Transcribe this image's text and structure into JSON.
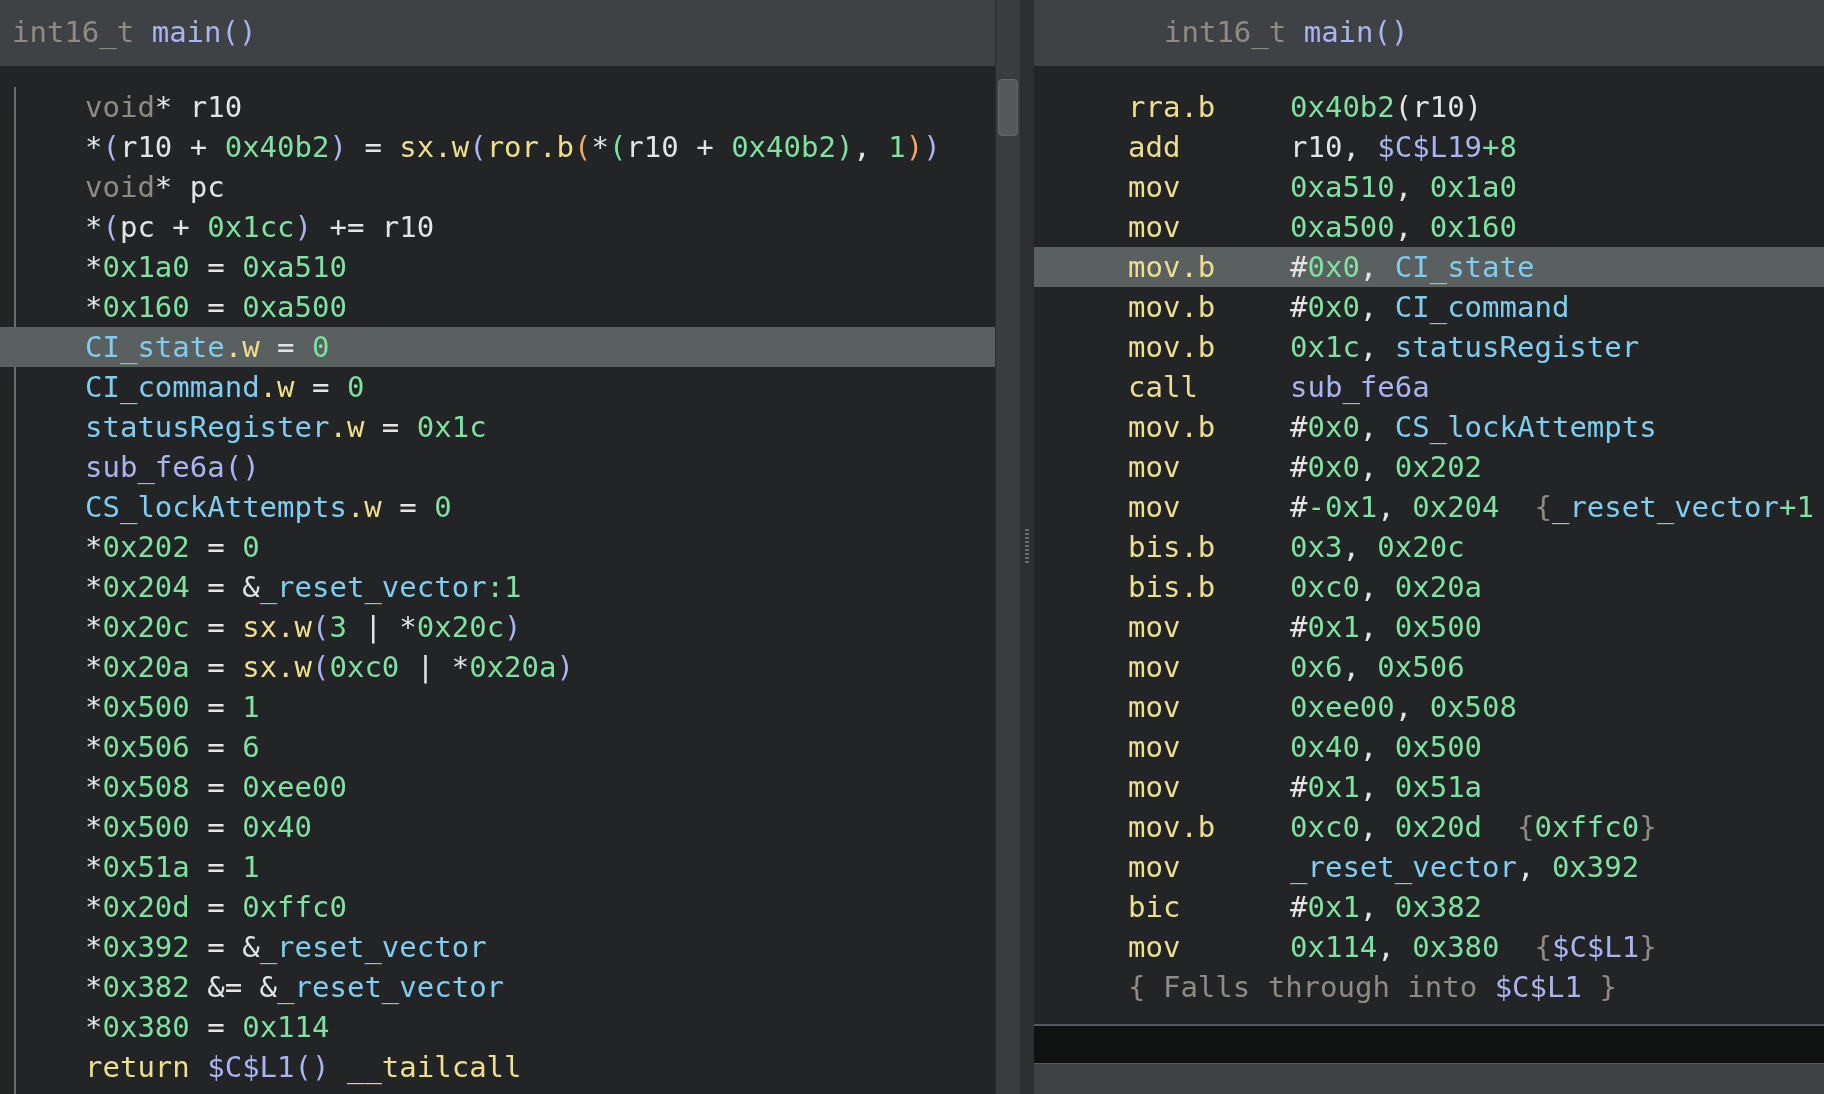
{
  "left_pane": {
    "header": [
      {
        "text": "int16_t ",
        "kind": "type"
      },
      {
        "text": "main",
        "kind": "func"
      },
      {
        "text": "()",
        "kind": "bracket"
      }
    ],
    "lines": [
      {
        "selected": false,
        "tokens": [
          {
            "text": "void",
            "kind": "type"
          },
          {
            "text": "* r10",
            "kind": "plain"
          }
        ]
      },
      {
        "selected": false,
        "tokens": [
          {
            "text": "*",
            "kind": "plain"
          },
          {
            "text": "(",
            "kind": "bracket"
          },
          {
            "text": "r10 + ",
            "kind": "plain"
          },
          {
            "text": "0x40b2",
            "kind": "number"
          },
          {
            "text": ")",
            "kind": "bracket"
          },
          {
            "text": " = ",
            "kind": "plain"
          },
          {
            "text": "sx.w",
            "kind": "keyword"
          },
          {
            "text": "(",
            "kind": "bracket"
          },
          {
            "text": "ror.b",
            "kind": "keyword"
          },
          {
            "text": "(",
            "kind": "bracket2"
          },
          {
            "text": "*",
            "kind": "plain"
          },
          {
            "text": "(",
            "kind": "number"
          },
          {
            "text": "r10 + ",
            "kind": "plain"
          },
          {
            "text": "0x40b2",
            "kind": "number"
          },
          {
            "text": ")",
            "kind": "number"
          },
          {
            "text": ", ",
            "kind": "plain"
          },
          {
            "text": "1",
            "kind": "number"
          },
          {
            "text": ")",
            "kind": "bracket2"
          },
          {
            "text": ")",
            "kind": "bracket"
          }
        ]
      },
      {
        "selected": false,
        "tokens": [
          {
            "text": "void",
            "kind": "type"
          },
          {
            "text": "* pc",
            "kind": "plain"
          }
        ]
      },
      {
        "selected": false,
        "tokens": [
          {
            "text": "*",
            "kind": "plain"
          },
          {
            "text": "(",
            "kind": "bracket"
          },
          {
            "text": "pc + ",
            "kind": "plain"
          },
          {
            "text": "0x1cc",
            "kind": "number"
          },
          {
            "text": ")",
            "kind": "bracket"
          },
          {
            "text": " += r10",
            "kind": "plain"
          }
        ]
      },
      {
        "selected": false,
        "tokens": [
          {
            "text": "*",
            "kind": "plain"
          },
          {
            "text": "0x1a0",
            "kind": "number"
          },
          {
            "text": " = ",
            "kind": "plain"
          },
          {
            "text": "0xa510",
            "kind": "number"
          }
        ]
      },
      {
        "selected": false,
        "tokens": [
          {
            "text": "*",
            "kind": "plain"
          },
          {
            "text": "0x160",
            "kind": "number"
          },
          {
            "text": " = ",
            "kind": "plain"
          },
          {
            "text": "0xa500",
            "kind": "number"
          }
        ]
      },
      {
        "selected": true,
        "tokens": [
          {
            "text": "CI_state",
            "kind": "data"
          },
          {
            "text": ".w",
            "kind": "keyword"
          },
          {
            "text": " = ",
            "kind": "plain"
          },
          {
            "text": "0",
            "kind": "number"
          }
        ]
      },
      {
        "selected": false,
        "tokens": [
          {
            "text": "CI_command",
            "kind": "data"
          },
          {
            "text": ".w",
            "kind": "keyword"
          },
          {
            "text": " = ",
            "kind": "plain"
          },
          {
            "text": "0",
            "kind": "number"
          }
        ]
      },
      {
        "selected": false,
        "tokens": [
          {
            "text": "statusRegister",
            "kind": "data"
          },
          {
            "text": ".w",
            "kind": "keyword"
          },
          {
            "text": " = ",
            "kind": "plain"
          },
          {
            "text": "0x1c",
            "kind": "number"
          }
        ]
      },
      {
        "selected": false,
        "tokens": [
          {
            "text": "sub_fe6a",
            "kind": "func"
          },
          {
            "text": "()",
            "kind": "bracket"
          }
        ]
      },
      {
        "selected": false,
        "tokens": [
          {
            "text": "CS_lockAttempts",
            "kind": "data"
          },
          {
            "text": ".w",
            "kind": "keyword"
          },
          {
            "text": " = ",
            "kind": "plain"
          },
          {
            "text": "0",
            "kind": "number"
          }
        ]
      },
      {
        "selected": false,
        "tokens": [
          {
            "text": "*",
            "kind": "plain"
          },
          {
            "text": "0x202",
            "kind": "number"
          },
          {
            "text": " = ",
            "kind": "plain"
          },
          {
            "text": "0",
            "kind": "number"
          }
        ]
      },
      {
        "selected": false,
        "tokens": [
          {
            "text": "*",
            "kind": "plain"
          },
          {
            "text": "0x204",
            "kind": "number"
          },
          {
            "text": " = &",
            "kind": "plain"
          },
          {
            "text": "_reset_vector",
            "kind": "data"
          },
          {
            "text": ":1",
            "kind": "number"
          }
        ]
      },
      {
        "selected": false,
        "tokens": [
          {
            "text": "*",
            "kind": "plain"
          },
          {
            "text": "0x20c",
            "kind": "number"
          },
          {
            "text": " = ",
            "kind": "plain"
          },
          {
            "text": "sx.w",
            "kind": "keyword"
          },
          {
            "text": "(",
            "kind": "bracket"
          },
          {
            "text": "3",
            "kind": "number"
          },
          {
            "text": " | *",
            "kind": "plain"
          },
          {
            "text": "0x20c",
            "kind": "number"
          },
          {
            "text": ")",
            "kind": "bracket"
          }
        ]
      },
      {
        "selected": false,
        "tokens": [
          {
            "text": "*",
            "kind": "plain"
          },
          {
            "text": "0x20a",
            "kind": "number"
          },
          {
            "text": " = ",
            "kind": "plain"
          },
          {
            "text": "sx.w",
            "kind": "keyword"
          },
          {
            "text": "(",
            "kind": "bracket"
          },
          {
            "text": "0xc0",
            "kind": "number"
          },
          {
            "text": " | *",
            "kind": "plain"
          },
          {
            "text": "0x20a",
            "kind": "number"
          },
          {
            "text": ")",
            "kind": "bracket"
          }
        ]
      },
      {
        "selected": false,
        "tokens": [
          {
            "text": "*",
            "kind": "plain"
          },
          {
            "text": "0x500",
            "kind": "number"
          },
          {
            "text": " = ",
            "kind": "plain"
          },
          {
            "text": "1",
            "kind": "number"
          }
        ]
      },
      {
        "selected": false,
        "tokens": [
          {
            "text": "*",
            "kind": "plain"
          },
          {
            "text": "0x506",
            "kind": "number"
          },
          {
            "text": " = ",
            "kind": "plain"
          },
          {
            "text": "6",
            "kind": "number"
          }
        ]
      },
      {
        "selected": false,
        "tokens": [
          {
            "text": "*",
            "kind": "plain"
          },
          {
            "text": "0x508",
            "kind": "number"
          },
          {
            "text": " = ",
            "kind": "plain"
          },
          {
            "text": "0xee00",
            "kind": "number"
          }
        ]
      },
      {
        "selected": false,
        "tokens": [
          {
            "text": "*",
            "kind": "plain"
          },
          {
            "text": "0x500",
            "kind": "number"
          },
          {
            "text": " = ",
            "kind": "plain"
          },
          {
            "text": "0x40",
            "kind": "number"
          }
        ]
      },
      {
        "selected": false,
        "tokens": [
          {
            "text": "*",
            "kind": "plain"
          },
          {
            "text": "0x51a",
            "kind": "number"
          },
          {
            "text": " = ",
            "kind": "plain"
          },
          {
            "text": "1",
            "kind": "number"
          }
        ]
      },
      {
        "selected": false,
        "tokens": [
          {
            "text": "*",
            "kind": "plain"
          },
          {
            "text": "0x20d",
            "kind": "number"
          },
          {
            "text": " = ",
            "kind": "plain"
          },
          {
            "text": "0xffc0",
            "kind": "number"
          }
        ]
      },
      {
        "selected": false,
        "tokens": [
          {
            "text": "*",
            "kind": "plain"
          },
          {
            "text": "0x392",
            "kind": "number"
          },
          {
            "text": " = &",
            "kind": "plain"
          },
          {
            "text": "_reset_vector",
            "kind": "data"
          }
        ]
      },
      {
        "selected": false,
        "tokens": [
          {
            "text": "*",
            "kind": "plain"
          },
          {
            "text": "0x382",
            "kind": "number"
          },
          {
            "text": " &= &",
            "kind": "plain"
          },
          {
            "text": "_reset_vector",
            "kind": "data"
          }
        ]
      },
      {
        "selected": false,
        "tokens": [
          {
            "text": "*",
            "kind": "plain"
          },
          {
            "text": "0x380",
            "kind": "number"
          },
          {
            "text": " = ",
            "kind": "plain"
          },
          {
            "text": "0x114",
            "kind": "number"
          }
        ]
      },
      {
        "selected": false,
        "tokens": [
          {
            "text": "return ",
            "kind": "keyword"
          },
          {
            "text": "$C$L1",
            "kind": "func"
          },
          {
            "text": "() ",
            "kind": "bracket"
          },
          {
            "text": "__tailcall",
            "kind": "keyword"
          }
        ]
      }
    ]
  },
  "right_pane": {
    "header": [
      {
        "text": "int16_t ",
        "kind": "type"
      },
      {
        "text": "main",
        "kind": "func"
      },
      {
        "text": "()",
        "kind": "bracket"
      }
    ],
    "lines": [
      {
        "kind": "instruction",
        "selected": false,
        "mnemonic": "rra.b",
        "operands": [
          {
            "text": "0x40b2",
            "kind": "number"
          },
          {
            "text": "(r10)",
            "kind": "plain"
          }
        ]
      },
      {
        "kind": "instruction",
        "selected": false,
        "mnemonic": "add",
        "operands": [
          {
            "text": "r10, ",
            "kind": "plain"
          },
          {
            "text": "$C$L19",
            "kind": "func"
          },
          {
            "text": "+8",
            "kind": "number"
          }
        ]
      },
      {
        "kind": "instruction",
        "selected": false,
        "mnemonic": "mov",
        "operands": [
          {
            "text": "0xa510",
            "kind": "number"
          },
          {
            "text": ", ",
            "kind": "plain"
          },
          {
            "text": "0x1a0",
            "kind": "number"
          }
        ]
      },
      {
        "kind": "instruction",
        "selected": false,
        "mnemonic": "mov",
        "operands": [
          {
            "text": "0xa500",
            "kind": "number"
          },
          {
            "text": ", ",
            "kind": "plain"
          },
          {
            "text": "0x160",
            "kind": "number"
          }
        ]
      },
      {
        "kind": "instruction",
        "selected": true,
        "mnemonic": "mov.b",
        "operands": [
          {
            "text": "#",
            "kind": "plain"
          },
          {
            "text": "0x0",
            "kind": "number"
          },
          {
            "text": ", ",
            "kind": "plain"
          },
          {
            "text": "CI_state",
            "kind": "data"
          }
        ]
      },
      {
        "kind": "instruction",
        "selected": false,
        "mnemonic": "mov.b",
        "operands": [
          {
            "text": "#",
            "kind": "plain"
          },
          {
            "text": "0x0",
            "kind": "number"
          },
          {
            "text": ", ",
            "kind": "plain"
          },
          {
            "text": "CI_command",
            "kind": "data"
          }
        ]
      },
      {
        "kind": "instruction",
        "selected": false,
        "mnemonic": "mov.b",
        "operands": [
          {
            "text": "0x1c",
            "kind": "number"
          },
          {
            "text": ", ",
            "kind": "plain"
          },
          {
            "text": "statusRegister",
            "kind": "data"
          }
        ]
      },
      {
        "kind": "instruction",
        "selected": false,
        "mnemonic": "call",
        "operands": [
          {
            "text": "sub_fe6a",
            "kind": "func"
          }
        ]
      },
      {
        "kind": "instruction",
        "selected": false,
        "mnemonic": "mov.b",
        "operands": [
          {
            "text": "#",
            "kind": "plain"
          },
          {
            "text": "0x0",
            "kind": "number"
          },
          {
            "text": ", ",
            "kind": "plain"
          },
          {
            "text": "CS_lockAttempts",
            "kind": "data"
          }
        ]
      },
      {
        "kind": "instruction",
        "selected": false,
        "mnemonic": "mov",
        "operands": [
          {
            "text": "#",
            "kind": "plain"
          },
          {
            "text": "0x0",
            "kind": "number"
          },
          {
            "text": ", ",
            "kind": "plain"
          },
          {
            "text": "0x202",
            "kind": "number"
          }
        ]
      },
      {
        "kind": "instruction",
        "selected": false,
        "mnemonic": "mov",
        "operands": [
          {
            "text": "#",
            "kind": "plain"
          },
          {
            "text": "-0x1",
            "kind": "number"
          },
          {
            "text": ", ",
            "kind": "plain"
          },
          {
            "text": "0x204",
            "kind": "number"
          },
          {
            "text": "  {",
            "kind": "comment"
          },
          {
            "text": "_reset_vector",
            "kind": "data"
          },
          {
            "text": "+1",
            "kind": "number"
          }
        ]
      },
      {
        "kind": "instruction",
        "selected": false,
        "mnemonic": "bis.b",
        "operands": [
          {
            "text": "0x3",
            "kind": "number"
          },
          {
            "text": ", ",
            "kind": "plain"
          },
          {
            "text": "0x20c",
            "kind": "number"
          }
        ]
      },
      {
        "kind": "instruction",
        "selected": false,
        "mnemonic": "bis.b",
        "operands": [
          {
            "text": "0xc0",
            "kind": "number"
          },
          {
            "text": ", ",
            "kind": "plain"
          },
          {
            "text": "0x20a",
            "kind": "number"
          }
        ]
      },
      {
        "kind": "instruction",
        "selected": false,
        "mnemonic": "mov",
        "operands": [
          {
            "text": "#",
            "kind": "plain"
          },
          {
            "text": "0x1",
            "kind": "number"
          },
          {
            "text": ", ",
            "kind": "plain"
          },
          {
            "text": "0x500",
            "kind": "number"
          }
        ]
      },
      {
        "kind": "instruction",
        "selected": false,
        "mnemonic": "mov",
        "operands": [
          {
            "text": "0x6",
            "kind": "number"
          },
          {
            "text": ", ",
            "kind": "plain"
          },
          {
            "text": "0x506",
            "kind": "number"
          }
        ]
      },
      {
        "kind": "instruction",
        "selected": false,
        "mnemonic": "mov",
        "operands": [
          {
            "text": "0xee00",
            "kind": "number"
          },
          {
            "text": ", ",
            "kind": "plain"
          },
          {
            "text": "0x508",
            "kind": "number"
          }
        ]
      },
      {
        "kind": "instruction",
        "selected": false,
        "mnemonic": "mov",
        "operands": [
          {
            "text": "0x40",
            "kind": "number"
          },
          {
            "text": ", ",
            "kind": "plain"
          },
          {
            "text": "0x500",
            "kind": "number"
          }
        ]
      },
      {
        "kind": "instruction",
        "selected": false,
        "mnemonic": "mov",
        "operands": [
          {
            "text": "#",
            "kind": "plain"
          },
          {
            "text": "0x1",
            "kind": "number"
          },
          {
            "text": ", ",
            "kind": "plain"
          },
          {
            "text": "0x51a",
            "kind": "number"
          }
        ]
      },
      {
        "kind": "instruction",
        "selected": false,
        "mnemonic": "mov.b",
        "operands": [
          {
            "text": "0xc0",
            "kind": "number"
          },
          {
            "text": ", ",
            "kind": "plain"
          },
          {
            "text": "0x20d",
            "kind": "number"
          },
          {
            "text": "  {",
            "kind": "comment"
          },
          {
            "text": "0xffc0",
            "kind": "number"
          },
          {
            "text": "}",
            "kind": "comment"
          }
        ]
      },
      {
        "kind": "instruction",
        "selected": false,
        "mnemonic": "mov",
        "operands": [
          {
            "text": "_reset_vector",
            "kind": "data"
          },
          {
            "text": ", ",
            "kind": "plain"
          },
          {
            "text": "0x392",
            "kind": "number"
          }
        ]
      },
      {
        "kind": "instruction",
        "selected": false,
        "mnemonic": "bic",
        "operands": [
          {
            "text": "#",
            "kind": "plain"
          },
          {
            "text": "0x1",
            "kind": "number"
          },
          {
            "text": ", ",
            "kind": "plain"
          },
          {
            "text": "0x382",
            "kind": "number"
          }
        ]
      },
      {
        "kind": "instruction",
        "selected": false,
        "mnemonic": "mov",
        "operands": [
          {
            "text": "0x114",
            "kind": "number"
          },
          {
            "text": ", ",
            "kind": "plain"
          },
          {
            "text": "0x380",
            "kind": "number"
          },
          {
            "text": "  {",
            "kind": "comment"
          },
          {
            "text": "$C$L1",
            "kind": "func"
          },
          {
            "text": "}",
            "kind": "comment"
          }
        ]
      },
      {
        "kind": "comment",
        "selected": false,
        "operands": [
          {
            "text": "{ Falls through into ",
            "kind": "comment"
          },
          {
            "text": "$C$L1",
            "kind": "func"
          },
          {
            "text": " }",
            "kind": "comment"
          }
        ]
      }
    ]
  }
}
